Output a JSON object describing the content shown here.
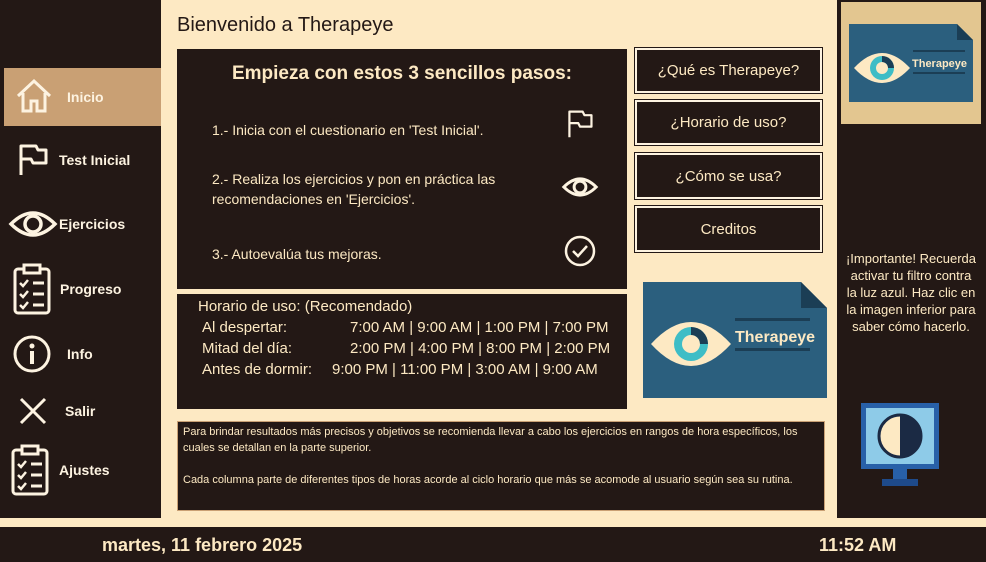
{
  "header": {
    "title": "Bienvenido a Therapeye"
  },
  "sidebar": {
    "items": [
      {
        "label": "Inicio",
        "icon": "home-icon",
        "active": true
      },
      {
        "label": "Test Inicial",
        "icon": "flag-icon"
      },
      {
        "label": "Ejercicios",
        "icon": "eye-icon"
      },
      {
        "label": "Progreso",
        "icon": "clipboard-list-icon"
      },
      {
        "label": "Info",
        "icon": "info-icon"
      },
      {
        "label": "Salir",
        "icon": "close-icon"
      },
      {
        "label": "Ajustes",
        "icon": "clipboard-list-icon"
      }
    ]
  },
  "steps": {
    "title": "Empieza con estos 3 sencillos pasos:",
    "items": [
      {
        "line1": "1.- Inicia con el cuestionario en 'Test Inicial'.",
        "line2": "",
        "icon": "flag-icon"
      },
      {
        "line1": "2.- Realiza los ejercicios y pon en práctica las",
        "line2": "recomendaciones en 'Ejercicios'.",
        "icon": "eye-icon"
      },
      {
        "line1": "3.- Autoevalúa tus mejoras.",
        "line2": "",
        "icon": "check-circle-icon"
      }
    ]
  },
  "menu": {
    "buttons": [
      "¿Qué es Therapeye?",
      "¿Horario de uso?",
      "¿Cómo se usa?",
      "Creditos"
    ]
  },
  "schedule": {
    "title": "Horario de uso: (Recomendado)",
    "rows": [
      {
        "label": "Al despertar:",
        "times": "7:00 AM | 9:00 AM  | 1:00 PM | 7:00 PM"
      },
      {
        "label": "Mitad del día:",
        "times": "2:00 PM | 4:00 PM   | 8:00 PM | 2:00 PM"
      },
      {
        "label": "Antes de dormir:",
        "times": "9:00 PM | 11:00 PM  | 3:00 AM | 9:00 AM"
      }
    ]
  },
  "note": {
    "p1": "Para brindar resultados más precisos y objetivos se recomienda llevar a cabo los ejercicios en rangos de hora específicos, los cuales se detallan en la parte superior.",
    "p2": "Cada columna parte de diferentes tipos de horas acorde al ciclo horario que más se acomode al usuario según sea su rutina."
  },
  "logo": {
    "text": "Therapeye"
  },
  "important": {
    "text": "¡Importante! Recuerda activar tu filtro contra la luz azul. Haz clic en la imagen inferior para saber cómo hacerlo."
  },
  "footer": {
    "date": "martes, 11 febrero 2025",
    "time": "11:52 AM"
  },
  "colors": {
    "background": "#fde9c3",
    "panel": "#231815",
    "accent": "#c9a074",
    "logo_blue": "#2b5f7e",
    "logo_teal": "#3ebdc6"
  }
}
